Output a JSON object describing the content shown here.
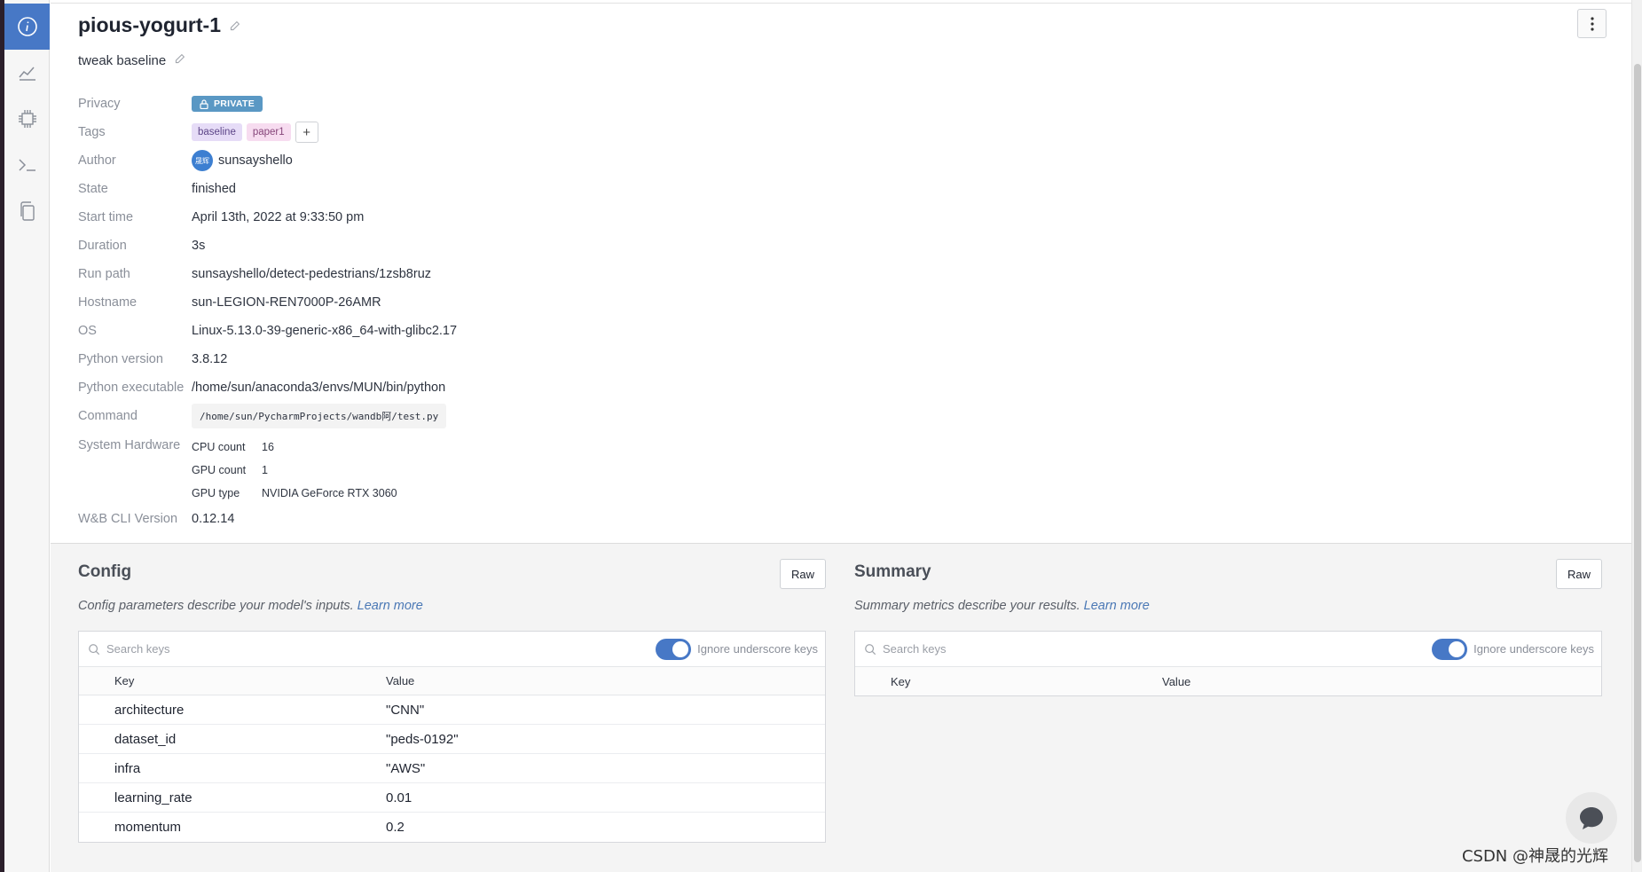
{
  "run": {
    "name": "pious-yogurt-1",
    "description": "tweak baseline"
  },
  "info": {
    "privacy_label": "Privacy",
    "privacy_badge": "PRIVATE",
    "tags_label": "Tags",
    "tags": [
      "baseline",
      "paper1"
    ],
    "add_tag": "+",
    "author_label": "Author",
    "author_avatar": "晟辉",
    "author": "sunsayshello",
    "state_label": "State",
    "state": "finished",
    "start_label": "Start time",
    "start": "April 13th, 2022 at 9:33:50 pm",
    "duration_label": "Duration",
    "duration": "3s",
    "runpath_label": "Run path",
    "runpath": "sunsayshello/detect-pedestrians/1zsb8ruz",
    "hostname_label": "Hostname",
    "hostname": "sun-LEGION-REN7000P-26AMR",
    "os_label": "OS",
    "os": "Linux-5.13.0-39-generic-x86_64-with-glibc2.17",
    "pyver_label": "Python version",
    "pyver": "3.8.12",
    "pyexe_label": "Python executable",
    "pyexe": "/home/sun/anaconda3/envs/MUN/bin/python",
    "command_label": "Command",
    "command": "/home/sun/PycharmProjects/wandb阿/test.py",
    "hw_label": "System Hardware",
    "hw": [
      {
        "k": "CPU count",
        "v": "16"
      },
      {
        "k": "GPU count",
        "v": "1"
      },
      {
        "k": "GPU type",
        "v": "NVIDIA GeForce RTX 3060"
      }
    ],
    "cli_label": "W&B CLI Version",
    "cli": "0.12.14"
  },
  "config": {
    "title": "Config",
    "raw": "Raw",
    "desc": "Config parameters describe your model's inputs.",
    "learn_more": "Learn more",
    "search_placeholder": "Search keys",
    "toggle_label": "Ignore underscore keys",
    "col_key": "Key",
    "col_value": "Value",
    "rows": [
      {
        "k": "architecture",
        "v": "\"CNN\""
      },
      {
        "k": "dataset_id",
        "v": "\"peds-0192\""
      },
      {
        "k": "infra",
        "v": "\"AWS\""
      },
      {
        "k": "learning_rate",
        "v": "0.01"
      },
      {
        "k": "momentum",
        "v": "0.2"
      }
    ]
  },
  "summary": {
    "title": "Summary",
    "raw": "Raw",
    "desc": "Summary metrics describe your results.",
    "learn_more": "Learn more",
    "search_placeholder": "Search keys",
    "toggle_label": "Ignore underscore keys",
    "col_key": "Key",
    "col_value": "Value"
  },
  "watermark": "CSDN @神晟的光辉",
  "colors": {
    "accent": "#4778c6",
    "private_badge": "#5a98c4",
    "tag_purple": "#e6dcf7",
    "tag_pink": "#f7dcf0"
  }
}
